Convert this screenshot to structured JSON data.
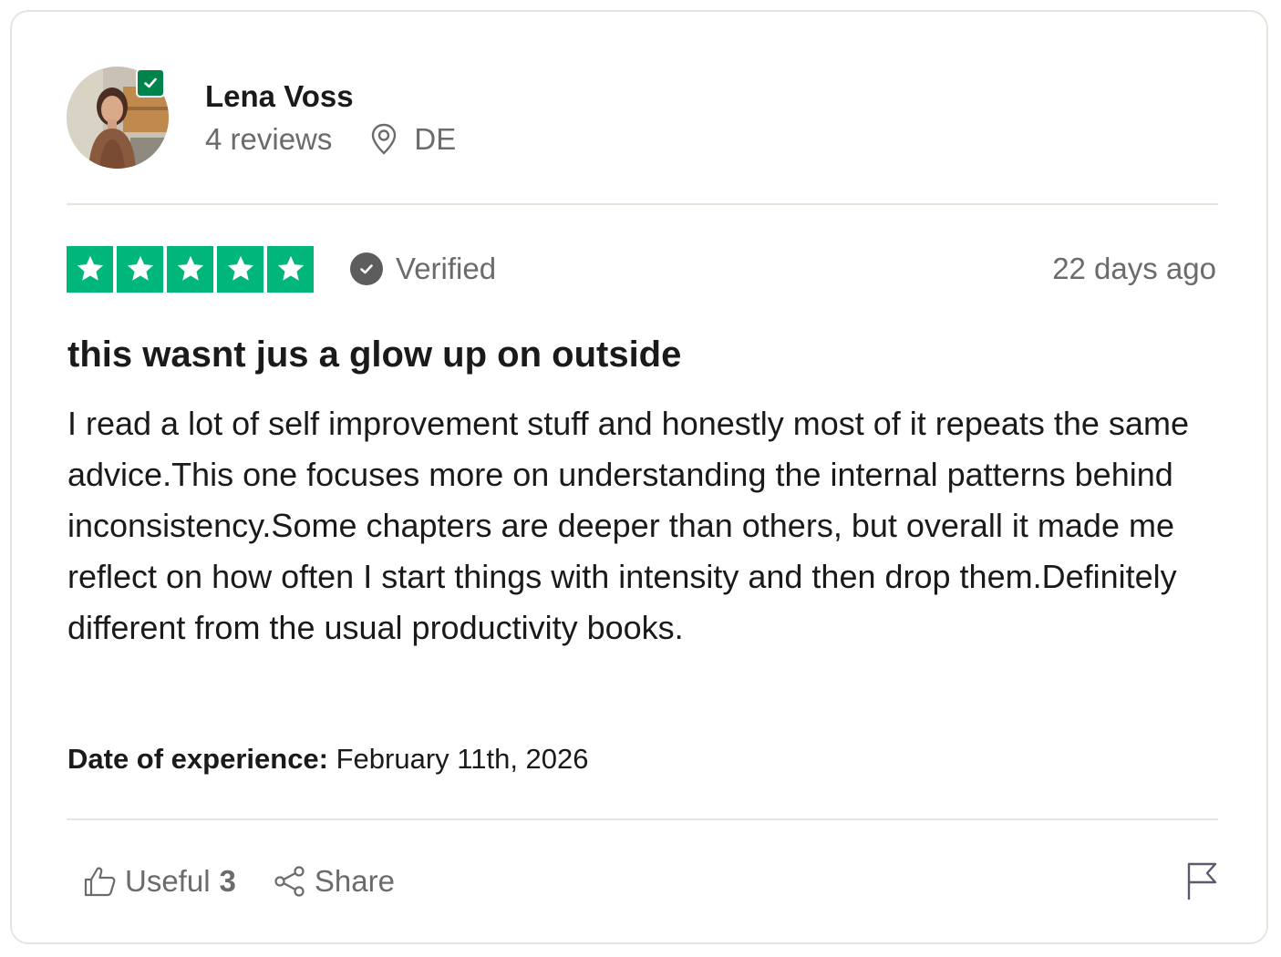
{
  "user": {
    "name": "Lena Voss",
    "reviews": "4 reviews",
    "country": "DE"
  },
  "review": {
    "stars": 5,
    "star_color": "#00b67a",
    "verified_label": "Verified",
    "date_ago": "22 days ago",
    "title": "this wasnt jus a glow up on outside",
    "body": "I read a lot of self improvement stuff and honestly most of it repeats the same advice.This one focuses more on understanding the internal patterns behind inconsistency.Some chapters are deeper than others, but overall it made me reflect on how often I start things with intensity and then drop them.Definitely different from the usual productivity books.",
    "experience_label": "Date of experience:",
    "experience_date": "February 11th, 2026"
  },
  "footer": {
    "useful_label": "Useful",
    "useful_count": "3",
    "share_label": "Share"
  },
  "icons": {
    "avatar_badge": "verified-check-icon",
    "location": "location-pin-icon",
    "verified": "check-circle-icon",
    "useful": "thumbs-up-icon",
    "share": "share-icon",
    "flag": "flag-icon"
  }
}
